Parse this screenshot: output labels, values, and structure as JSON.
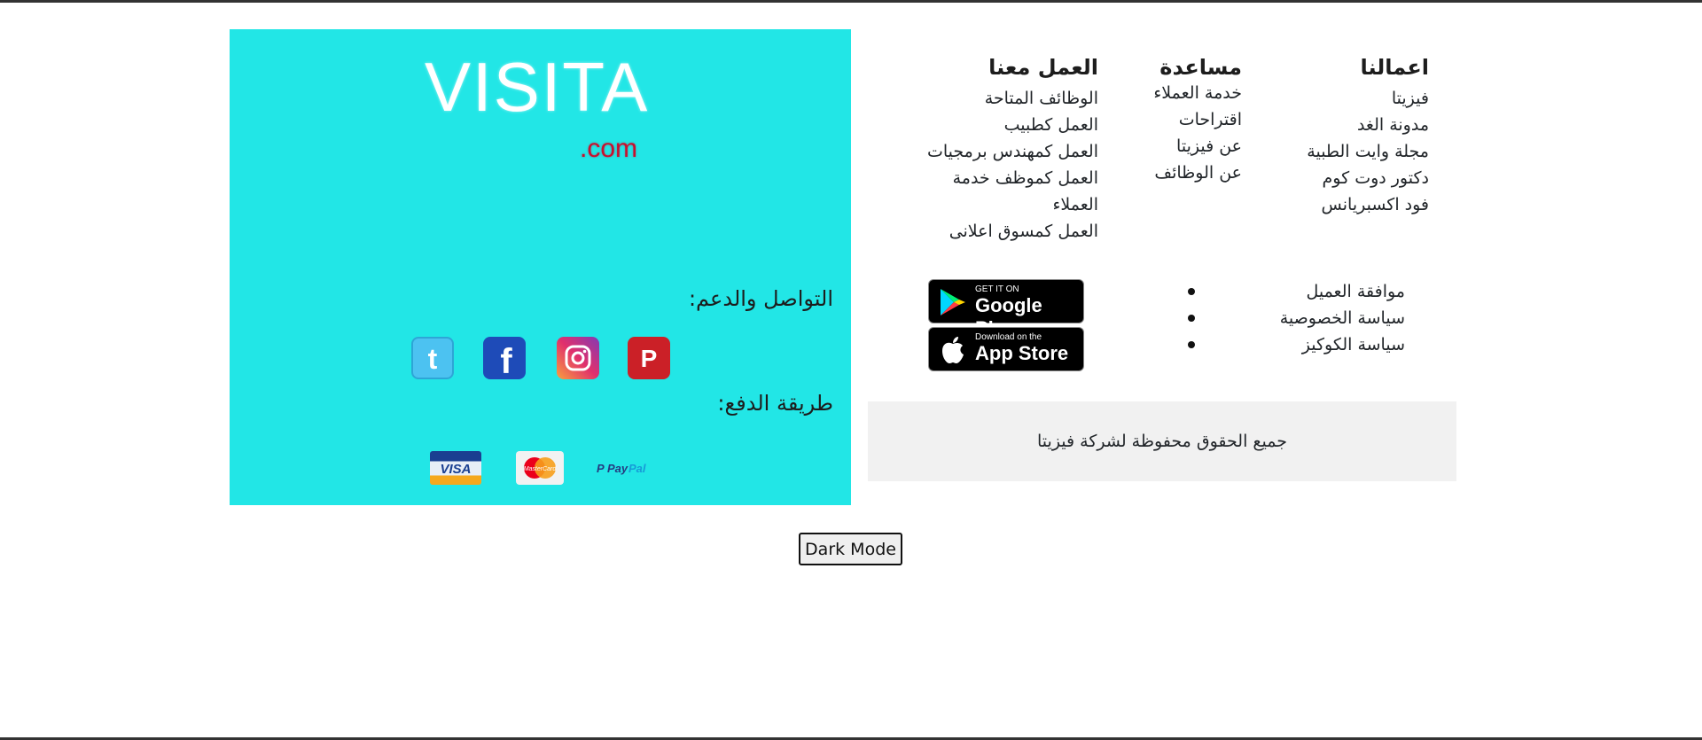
{
  "brand": {
    "logo_main": "VISITA",
    "logo_sub": ".com"
  },
  "social_section": {
    "title": "التواصل والدعم:",
    "icons": [
      "pinterest-icon",
      "instagram-icon",
      "facebook-icon",
      "twitter-icon"
    ]
  },
  "payment_section": {
    "title": "طريقة الدفع:",
    "methods": [
      "VISA",
      "MasterCard",
      "PayPal"
    ]
  },
  "columns": {
    "our_work": {
      "title": "اعمالنا",
      "items": [
        "فيزيتا",
        "مدونة الغد",
        "مجلة وايت الطبية",
        "دكتور دوت كوم",
        "فود اكسبريانس"
      ]
    },
    "help": {
      "title": "مساعدة",
      "items": [
        "خدمة العملاء",
        "اقتراحات",
        "عن فيزيتا",
        "عن الوظائف"
      ]
    },
    "jobs": {
      "title": "العمل معنا",
      "items": [
        "الوظائف المتاحة",
        "العمل كطبيب",
        "العمل كمهندس برمجيات",
        "العمل كموظف خدمة العملاء",
        "العمل كمسوق اعلانى"
      ]
    }
  },
  "legal": [
    "موافقة العميل",
    "سياسة الخصوصية",
    "سياسة الكوكيز"
  ],
  "stores": {
    "google_play": {
      "small": "GET IT ON",
      "big": "Google Play"
    },
    "app_store": {
      "small": "Download on the",
      "big": "App Store"
    }
  },
  "copyright": "جميع الحقوق محفوظة لشركة فيزيتا",
  "dark_mode_label": "Dark Mode",
  "colors": {
    "panel": "#22e6e6",
    "copyright_bg": "#f1f1f1"
  }
}
